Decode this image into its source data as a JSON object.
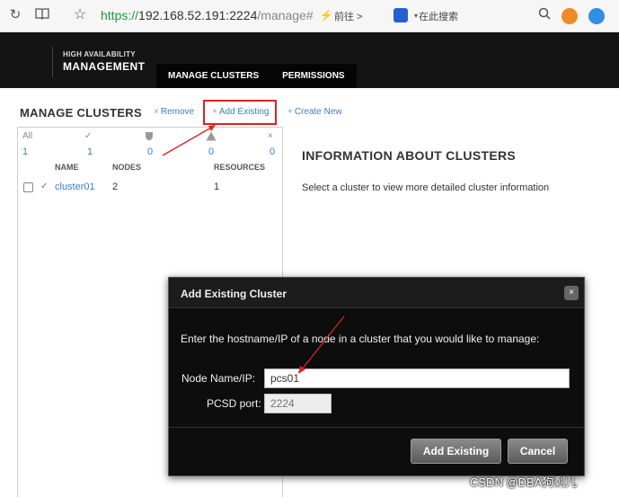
{
  "browser": {
    "url_scheme": "https://",
    "url_host": "192.168.52.191:2224",
    "url_path": "/manage#",
    "goto_label": "前往 >",
    "search_placeholder": "在此搜索"
  },
  "header": {
    "brand_top": "HIGH AVAILABILITY",
    "brand_bottom": "MANAGEMENT",
    "tabs": [
      {
        "label": "MANAGE CLUSTERS"
      },
      {
        "label": "PERMISSIONS"
      }
    ]
  },
  "toolbar": {
    "title": "MANAGE CLUSTERS",
    "remove_label": "Remove",
    "add_existing_label": "Add Existing",
    "create_new_label": "Create New"
  },
  "cluster_list": {
    "stats_headers": {
      "all": "All"
    },
    "stats_values": [
      "1",
      "1",
      "0",
      "0",
      "0"
    ],
    "columns": {
      "name": "NAME",
      "nodes": "NODES",
      "resources": "RESOURCES"
    },
    "rows": [
      {
        "name": "cluster01",
        "nodes": "2",
        "resources": "1"
      }
    ]
  },
  "info": {
    "title": "INFORMATION ABOUT CLUSTERS",
    "text": "Select a cluster to view more detailed cluster information"
  },
  "modal": {
    "title": "Add Existing Cluster",
    "close_glyph": "×",
    "message": "Enter the hostname/IP of a node in a cluster that you would like to manage:",
    "node_label": "Node Name/IP:",
    "node_value": "pcs01",
    "port_label": "PCSD port:",
    "port_placeholder": "2224",
    "add_button": "Add Existing",
    "cancel_button": "Cancel"
  },
  "watermark": "CSDN @DBA狗剩儿",
  "colors": {
    "link": "#3b7fc7",
    "annotation": "#e02020",
    "header_bg": "#141414"
  }
}
